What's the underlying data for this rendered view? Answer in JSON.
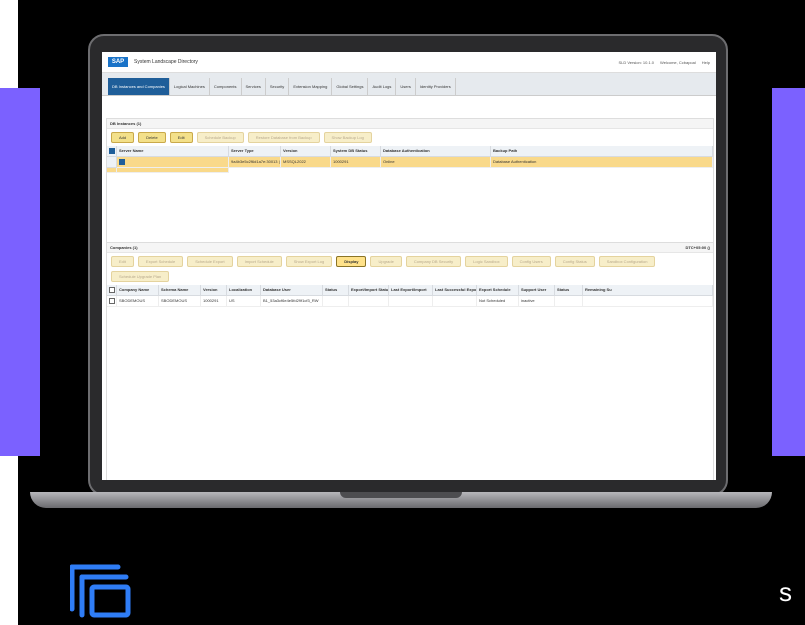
{
  "sap": {
    "logo": "SAP",
    "app_title": "System Landscape Directory",
    "header_right": {
      "version": "SLD Version: 10.1.0",
      "welcome": "Welcome, Ccbapoal",
      "help": "Help"
    }
  },
  "tabs": [
    "DB Instances and Companies",
    "Logical Machines",
    "Components",
    "Services",
    "Security",
    "Extension Mapping",
    "Global Settings",
    "Audit Logs",
    "Users",
    "Identity Providers"
  ],
  "db_instances": {
    "title": "DB Instances (1)",
    "buttons": [
      {
        "label": "Add",
        "state": "enabled"
      },
      {
        "label": "Delete",
        "state": "enabled"
      },
      {
        "label": "Edit",
        "state": "enabled"
      },
      {
        "label": "Schedule Backup",
        "state": "disabled"
      },
      {
        "label": "Restore Database from Backup",
        "state": "disabled"
      },
      {
        "label": "Show Backup Log",
        "state": "disabled"
      }
    ],
    "columns": [
      "Server Name",
      "Server Type",
      "Version",
      "System DB Status",
      "Database Authentication",
      "Backup Path"
    ],
    "rows": [
      [
        "9a4b3e5c2f6d1a7e:30013 | SEC0 1453",
        "MSSQL2022",
        "1000291",
        "Online",
        "Database Authentication",
        ""
      ]
    ]
  },
  "companies": {
    "title": "Companies (1)",
    "right_text": "DTC+05:00 ()",
    "buttons": [
      {
        "label": "Edit",
        "state": "disabled"
      },
      {
        "label": "Export Schedule",
        "state": "disabled"
      },
      {
        "label": "Schedule Export",
        "state": "disabled"
      },
      {
        "label": "Import Schedule",
        "state": "disabled"
      },
      {
        "label": "Show Export Log",
        "state": "disabled"
      },
      {
        "label": "Display",
        "state": "primary"
      },
      {
        "label": "Upgrade",
        "state": "disabled"
      },
      {
        "label": "Company DB Security",
        "state": "disabled"
      },
      {
        "label": "Logic Sandbox",
        "state": "disabled"
      },
      {
        "label": "Config Users",
        "state": "disabled"
      },
      {
        "label": "Config Status",
        "state": "disabled"
      },
      {
        "label": "Sandbox Configuration",
        "state": "disabled"
      },
      {
        "label": "Schedule Upgrade Plan",
        "state": "disabled"
      }
    ],
    "columns": [
      "Company Name",
      "Schema Name",
      "Version",
      "Localization",
      "Database User",
      "Status",
      "Export/Import Status",
      "Last Export/Import",
      "Last Successful Export",
      "Export Schedule",
      "Support User",
      "Status",
      "Remaining Su"
    ],
    "rows": [
      [
        "SBODEMOUS",
        "SBODEMOUS",
        "1000291",
        "US",
        "B1_53a3cf6e4e5fd29f1cf3_RW",
        "",
        "",
        "",
        "",
        "Not Scheduled",
        "inactive",
        "",
        ""
      ]
    ]
  }
}
